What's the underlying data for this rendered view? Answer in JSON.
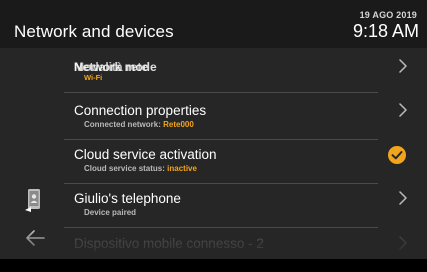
{
  "header": {
    "title": "Network and devices",
    "date": "19 AGO 2019",
    "time": "9:18 AM"
  },
  "rows": [
    {
      "label": "Network mode",
      "label_overlap": "Modalità rete",
      "sub_value": "Wi-Fi"
    },
    {
      "label": "Connection properties",
      "sub_prefix": "Connected network: ",
      "sub_value": "Rete000"
    },
    {
      "label": "Cloud service activation",
      "sub_prefix": "Cloud service status: ",
      "sub_value": "inactive"
    },
    {
      "label": "Giulio's telephone",
      "sub_prefix": "Device paired"
    },
    {
      "label": "Dispositivo mobile connesso - 2"
    }
  ],
  "icons": {
    "chevron": "chevron-right-icon",
    "check": "check-circle-icon",
    "phone": "smartphone-user-icon",
    "back": "back-arrow-icon"
  },
  "colors": {
    "background": "#262626",
    "header": "#1a1a1a",
    "accent": "#f2a51a",
    "divider": "#4a4a4a"
  }
}
